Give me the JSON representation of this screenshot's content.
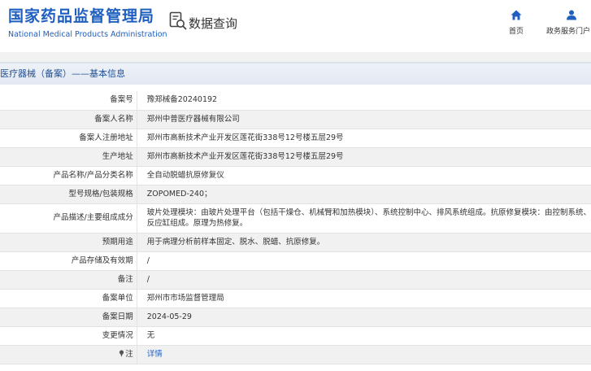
{
  "header": {
    "brand_cn": "国家药品监督管理局",
    "brand_en": "National Medical Products Administration",
    "query_label": "数据查询",
    "nav": [
      {
        "label": "首页",
        "icon": "home-icon"
      },
      {
        "label": "政务服务门户",
        "icon": "user-icon"
      }
    ]
  },
  "section": {
    "title": "医疗器械（备案）——基本信息"
  },
  "rows": [
    {
      "label": "备案号",
      "value": "豫郑械备20240192"
    },
    {
      "label": "备案人名称",
      "value": "郑州中普医疗器械有限公司"
    },
    {
      "label": "备案人注册地址",
      "value": "郑州市高新技术产业开发区莲花街338号12号楼五层29号"
    },
    {
      "label": "生产地址",
      "value": "郑州市高新技术产业开发区莲花街338号12号楼五层29号"
    },
    {
      "label": "产品名称/产品分类名称",
      "value": "全自动脱蜡抗原修复仪"
    },
    {
      "label": "型号规格/包装规格",
      "value": "ZOPOMED-240；"
    },
    {
      "label": "产品描述/主要组成成分",
      "value_line1": "玻片处理模块：由玻片处理平台（包括干燥仓、机械臂和加热模块）、系统控制中心、排风系统组成。抗原修复模块：由控制系统、",
      "value_line2": "反应缸组成。原理为热修复。"
    },
    {
      "label": "预期用途",
      "value": "用于病理分析前样本固定、脱水、脱蜡、抗原修复。"
    },
    {
      "label": "产品存储及有效期",
      "value": "/"
    },
    {
      "label": "备注",
      "value": "/"
    },
    {
      "label": "备案单位",
      "value": "郑州市市场监督管理局"
    },
    {
      "label": "备案日期",
      "value": "2024-05-29"
    },
    {
      "label": "变更情况",
      "value": "无"
    },
    {
      "label": "注",
      "value": "详情",
      "icon": "pin-icon"
    }
  ],
  "colors": {
    "brand_blue": "#1f5fbf",
    "section_text": "#1f4f96",
    "row_alt": "#f1f1f1",
    "border": "#e3e3e3"
  }
}
